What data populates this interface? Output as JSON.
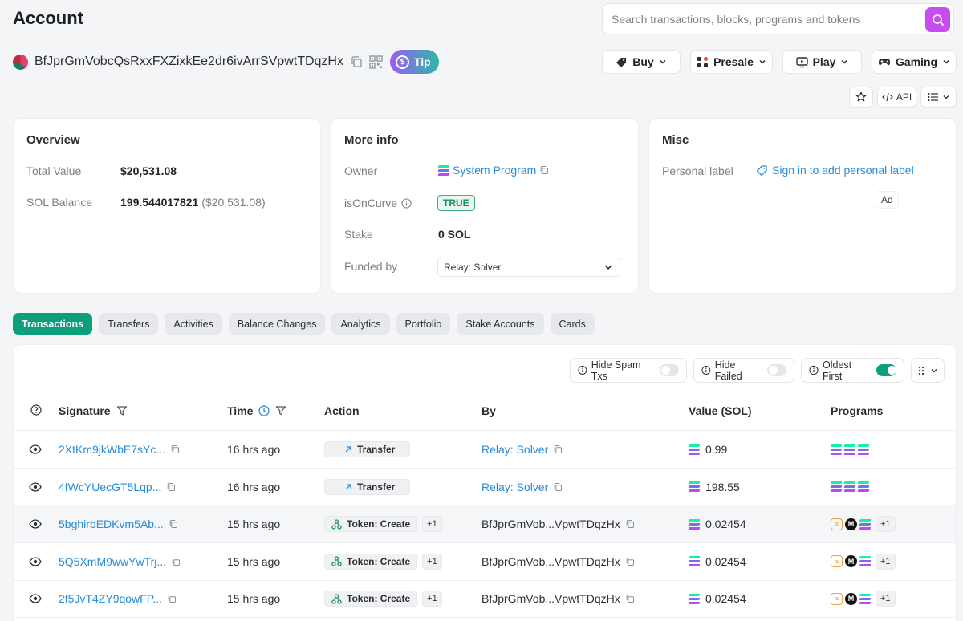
{
  "header": {
    "title": "Account",
    "search_placeholder": "Search transactions, blocks, programs and tokens"
  },
  "account": {
    "address": "BfJprGmVobcQsRxxFXZixkEe2dr6ivArrSVpwtTDqzHx",
    "tip_label": "Tip"
  },
  "top_nav": [
    {
      "label": "Buy",
      "icon": "tag-icon"
    },
    {
      "label": "Presale",
      "icon": "blocks-icon"
    },
    {
      "label": "Play",
      "icon": "monitor-icon"
    },
    {
      "label": "Gaming",
      "icon": "gamepad-icon"
    }
  ],
  "tools": {
    "api_label": "API"
  },
  "overview": {
    "title": "Overview",
    "total_value_label": "Total Value",
    "total_value": "$20,531.08",
    "sol_balance_label": "SOL Balance",
    "sol_balance": "199.544017821",
    "sol_balance_usd": "($20,531.08)"
  },
  "more_info": {
    "title": "More info",
    "owner_label": "Owner",
    "owner_value": "System Program",
    "is_on_curve_label": "isOnCurve",
    "is_on_curve_value": "TRUE",
    "stake_label": "Stake",
    "stake_value": "0 SOL",
    "funded_by_label": "Funded by",
    "funded_by_value": "Relay: Solver"
  },
  "misc": {
    "title": "Misc",
    "personal_label": "Personal label",
    "personal_label_link": "Sign in to add personal label",
    "ad_label": "Ad"
  },
  "tabs": [
    "Transactions",
    "Transfers",
    "Activities",
    "Balance Changes",
    "Analytics",
    "Portfolio",
    "Stake Accounts",
    "Cards"
  ],
  "filters": {
    "hide_spam": "Hide Spam Txs",
    "hide_failed": "Hide Failed",
    "oldest_first": "Oldest First",
    "hide_spam_on": false,
    "hide_failed_on": false,
    "oldest_first_on": true
  },
  "table": {
    "headers": {
      "signature": "Signature",
      "time": "Time",
      "action": "Action",
      "by": "By",
      "value": "Value (SOL)",
      "programs": "Programs"
    },
    "rows": [
      {
        "signature": "2XtKm9jkWbE7sYc...",
        "time": "16 hrs ago",
        "action": "Transfer",
        "action_type": "transfer",
        "action_extra": "",
        "by": "Relay: Solver",
        "by_link": true,
        "value": "0.99",
        "programs": "sol3",
        "programs_extra": ""
      },
      {
        "signature": "4fWcYUecGT5Lqp...",
        "time": "16 hrs ago",
        "action": "Transfer",
        "action_type": "transfer",
        "action_extra": "",
        "by": "Relay: Solver",
        "by_link": true,
        "value": "198.55",
        "programs": "sol3",
        "programs_extra": ""
      },
      {
        "signature": "5bghirbEDKvm5Ab...",
        "time": "15 hrs ago",
        "action": "Token: Create",
        "action_type": "token",
        "action_extra": "+1",
        "by": "BfJprGmVob...VpwtTDqzHx",
        "by_link": false,
        "value": "0.02454",
        "programs": "mix",
        "programs_extra": "+1"
      },
      {
        "signature": "5Q5XmM9wwYwTrj...",
        "time": "15 hrs ago",
        "action": "Token: Create",
        "action_type": "token",
        "action_extra": "+1",
        "by": "BfJprGmVob...VpwtTDqzHx",
        "by_link": false,
        "value": "0.02454",
        "programs": "mix",
        "programs_extra": "+1"
      },
      {
        "signature": "2f5JvT4ZY9qowFP...",
        "time": "15 hrs ago",
        "action": "Token: Create",
        "action_type": "token",
        "action_extra": "+1",
        "by": "BfJprGmVob...VpwtTDqzHx",
        "by_link": false,
        "value": "0.02454",
        "programs": "mix",
        "programs_extra": "+1"
      }
    ]
  },
  "colors": {
    "accent": "#0d9e7c",
    "link": "#2a8bd8",
    "search": "#c84cf0"
  }
}
